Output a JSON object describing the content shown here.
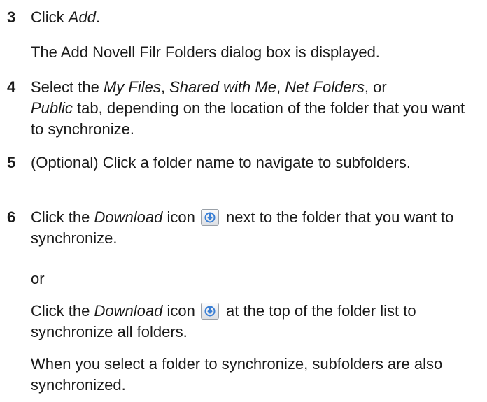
{
  "steps": [
    {
      "number": "3",
      "lines": {
        "pre": "Click ",
        "em": "Add",
        "post": "."
      }
    },
    {
      "number": "4",
      "pre": "Select the ",
      "tab1": "My Files",
      "sep1": ", ",
      "tab2": "Shared with Me",
      "sep2": ", ",
      "tab3": "Net Folders",
      "sep3": ", or",
      "tab4": "Public",
      "post": " tab, depending on the location of the folder that you want to synchronize."
    },
    {
      "number": "5",
      "text": "(Optional) Click a folder name to navigate to subfolders."
    },
    {
      "number": "6",
      "pre": "Click the ",
      "em": "Download",
      "mid": " icon",
      "post": " next to the folder that you want to synchronize."
    }
  ],
  "result_3": "The Add Novell Filr Folders dialog box is displayed.",
  "or_label": "or",
  "alt_step": {
    "pre": "Click the ",
    "em": "Download",
    "mid": " icon",
    "post": " at the top of the folder list to synchronize all folders."
  },
  "note": "When you select a folder to synchronize, subfolders are also synchronized.",
  "icons": {
    "download": "download-icon",
    "icon_color": "#3a7fd5"
  }
}
